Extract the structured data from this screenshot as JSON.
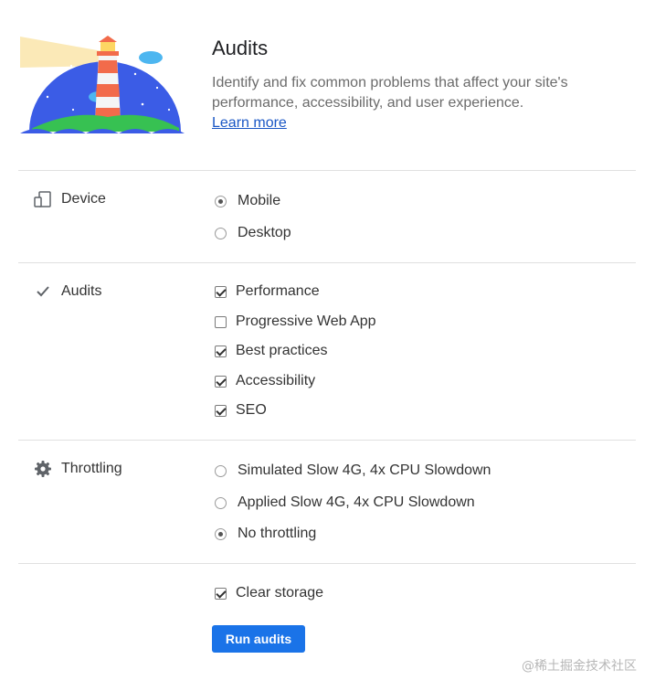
{
  "header": {
    "title": "Audits",
    "description": "Identify and fix common problems that affect your site's performance, accessibility, and user experience.",
    "learn_more": "Learn more"
  },
  "device": {
    "label": "Device",
    "icon": "device-icon",
    "options": [
      {
        "label": "Mobile",
        "checked": true
      },
      {
        "label": "Desktop",
        "checked": false
      }
    ]
  },
  "audits": {
    "label": "Audits",
    "icon": "checkmark-icon",
    "options": [
      {
        "label": "Performance",
        "checked": true
      },
      {
        "label": "Progressive Web App",
        "checked": false
      },
      {
        "label": "Best practices",
        "checked": true
      },
      {
        "label": "Accessibility",
        "checked": true
      },
      {
        "label": "SEO",
        "checked": true
      }
    ]
  },
  "throttling": {
    "label": "Throttling",
    "icon": "gear-icon",
    "options": [
      {
        "label": "Simulated Slow 4G, 4x CPU Slowdown",
        "checked": false
      },
      {
        "label": "Applied Slow 4G, 4x CPU Slowdown",
        "checked": false
      },
      {
        "label": "No throttling",
        "checked": true
      }
    ]
  },
  "storage": {
    "label": "Clear storage",
    "checked": true
  },
  "run_button": "Run audits",
  "watermark": "@稀土掘金技术社区",
  "colors": {
    "accent": "#1a73e8",
    "link": "#1a57c5"
  }
}
